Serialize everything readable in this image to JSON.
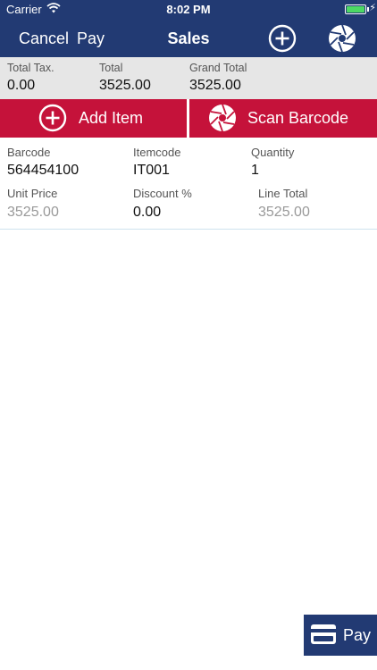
{
  "status_bar": {
    "carrier": "Carrier",
    "time": "8:02 PM"
  },
  "nav": {
    "cancel_label": "Cancel",
    "pay_label": "Pay",
    "title": "Sales"
  },
  "totals": {
    "total_tax_label": "Total Tax.",
    "total_tax_value": "0.00",
    "total_label": "Total",
    "total_value": "3525.00",
    "grand_total_label": "Grand Total",
    "grand_total_value": "3525.00"
  },
  "actions": {
    "add_item_label": "Add Item",
    "scan_barcode_label": "Scan Barcode"
  },
  "line_items": [
    {
      "barcode_label": "Barcode",
      "barcode": "564454100",
      "itemcode_label": "Itemcode",
      "itemcode": "IT001",
      "quantity_label": "Quantity",
      "quantity": "1",
      "unit_price_label": "Unit Price",
      "unit_price": "3525.00",
      "discount_label": "Discount %",
      "discount": "0.00",
      "line_total_label": "Line Total",
      "line_total": "3525.00"
    }
  ],
  "pay_button": {
    "label": "Pay"
  },
  "colors": {
    "nav": "#223a73",
    "accent": "#c5123a",
    "totals_bg": "#e6e6e6",
    "battery": "#4cd964"
  },
  "icons": {
    "add": "plus-circle-icon",
    "camera": "camera-shutter-icon",
    "card": "credit-card-icon",
    "wifi": "wifi-icon",
    "battery": "battery-icon"
  }
}
